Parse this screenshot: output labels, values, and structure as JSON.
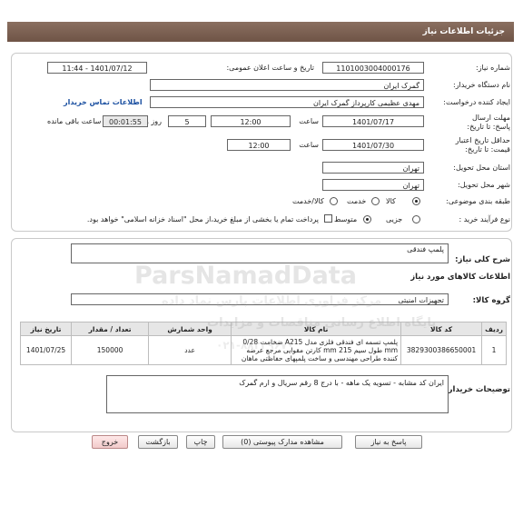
{
  "header": {
    "title": "جزئیات اطلاعات نیاز"
  },
  "form": {
    "need_number_label": "شماره نیاز:",
    "need_number": "1101003004000176",
    "announce_label": "تاریخ و ساعت اعلان عمومی:",
    "announce_value": "1401/07/12 - 11:44",
    "buyer_org_label": "نام دستگاه خریدار:",
    "buyer_org": "گمرک ایران",
    "creator_label": "ایجاد کننده درخواست:",
    "creator": "مهدی عظیمی کارپرداز گمرک ایران",
    "contact_link": "اطلاعات تماس خریدار",
    "deadline_label": "مهلت ارسال پاسخ: تا تاریخ:",
    "deadline_date": "1401/07/17",
    "time_label": "ساعت",
    "deadline_time": "12:00",
    "days_value": "5",
    "days_label": "روز و",
    "remaining_time": "00:01:55",
    "remaining_label": "ساعت باقی مانده",
    "min_price_label": "حداقل تاریخ اعتبار قیمت: تا تاریخ:",
    "min_price_date": "1401/07/30",
    "min_price_time_label": "ساعت",
    "min_price_time": "12:00",
    "province_label": "استان محل تحویل:",
    "province": "تهران",
    "city_label": "شهر محل تحویل:",
    "city": "تهران",
    "category_label": "طبقه بندی موضوعی:",
    "category_options": [
      "کالا",
      "خدمت",
      "کالا/خدمت"
    ],
    "process_label": "نوع فرآیند خرید :",
    "process_options": [
      "جزیی",
      "متوسط"
    ],
    "payment_note": "پرداخت تمام یا بخشی از مبلغ خرید،از محل \"اسناد خزانه اسلامی\" خواهد بود."
  },
  "need": {
    "summary_label": "شرح کلی نیاز:",
    "summary": "پلمپ فندقی",
    "goods_title": "اطلاعات کالاهای مورد نیاز",
    "group_label": "گروه کالا:",
    "group": "تجهیزات امنیتی"
  },
  "table": {
    "headers": [
      "ردیف",
      "کد کالا",
      "نام کالا",
      "واحد شمارش",
      "تعداد / مقدار",
      "تاریخ نیاز"
    ],
    "rows": [
      {
        "row": "1",
        "code": "3829300386650001",
        "name": "پلمپ تسمه ای فندقی فلزی مدل A215 ضخامت 0/28 mm طول سیم 215 mm کارتن مقوایی مرجع عرضه کننده طراحی مهندسی و ساخت پلمپهای حفاظتی ماهان",
        "unit": "عدد",
        "qty": "150000",
        "date": "1401/07/25"
      }
    ]
  },
  "buyer_notes": {
    "label": "توضیحات خریدار:",
    "text": "ایران کد مشابه - تسویه یک ماهه - با درج 8 رقم سریال و ارم گمرک"
  },
  "buttons": {
    "reply": "پاسخ به نیاز",
    "attachments": "مشاهده مدارک پیوستی (0)",
    "print": "چاپ",
    "back": "بازگشت",
    "exit": "خروج"
  },
  "watermark": {
    "brand": "ParsNamadData",
    "line1": "مرکز فراوری اطلاعات پارس نماد داده",
    "line2": "پایگاه اطلاع رسانی مناقصات و مزایدات",
    "phone": "۰۲۱-۸۸۳۴۹۶۷۰"
  },
  "colors": {
    "title_bar": "#7a5f50",
    "link": "#1a4fa0",
    "exit_button": "#f2caca"
  }
}
